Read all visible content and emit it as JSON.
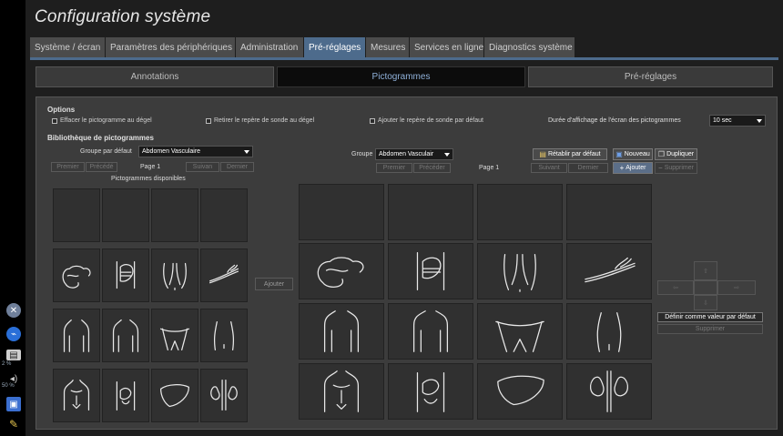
{
  "title": "Configuration système",
  "tabs": [
    {
      "label": "Système / écran"
    },
    {
      "label": "Paramètres des périphériques"
    },
    {
      "label": "Administration"
    },
    {
      "label": "Pré-réglages",
      "active": true
    },
    {
      "label": "Mesures"
    },
    {
      "label": "Services en ligne"
    },
    {
      "label": "Diagnostics système"
    }
  ],
  "subtabs": [
    {
      "label": "Annotations"
    },
    {
      "label": "Pictogrammes",
      "active": true
    },
    {
      "label": "Pré-réglages"
    }
  ],
  "options": {
    "heading": "Options",
    "erase_on_unfreeze": "Effacer le pictogramme au dégel",
    "remove_probe_marker": "Retirer le repère de sonde au dégel",
    "add_probe_marker": "Ajouter le repère de sonde par défaut",
    "display_duration_label": "Durée d'affichage de l'écran des pictogrammes",
    "display_duration_value": "10 sec"
  },
  "library": {
    "heading": "Bibliothèque de pictogrammes",
    "default_group_label": "Groupe par défaut",
    "default_group_value": "Abdomen Vasculaire",
    "group_label": "Groupe",
    "group_value": "Abdomen Vasculair",
    "available_label": "Pictogrammes disponibles",
    "left_nav": {
      "first": "Premier",
      "prev": "Précédé",
      "page": "Page 1",
      "next": "Suivan",
      "last": "Dernier"
    },
    "right_nav": {
      "first": "Premier",
      "prev": "Précéder",
      "page": "Page 1",
      "next": "Suivant",
      "last": "Dernier"
    },
    "add_button": "Ajouter",
    "restore_default": "Rétablir par défaut",
    "new": "Nouveau",
    "duplicate": "Dupliquer",
    "add": "Ajouter",
    "delete": "Supprimer",
    "set_default": "Définir comme valeur par défaut",
    "delete_bottom": "Supprimer"
  },
  "pictograms": [
    "colon-icon",
    "stomach-icon",
    "pelvis-vessels-icon",
    "vessel-branch-icon",
    "male-torso-icon",
    "torso-front-icon",
    "hip-region-icon",
    "waist-icon",
    "chest-icon",
    "abdomen-organs-icon",
    "liver-icon",
    "kidneys-icon"
  ],
  "status_bar": {
    "volume1": "2 %",
    "volume2": "50 %"
  },
  "colors": {
    "accent": "#4d6b8c",
    "panel": "#3c3c3c"
  }
}
